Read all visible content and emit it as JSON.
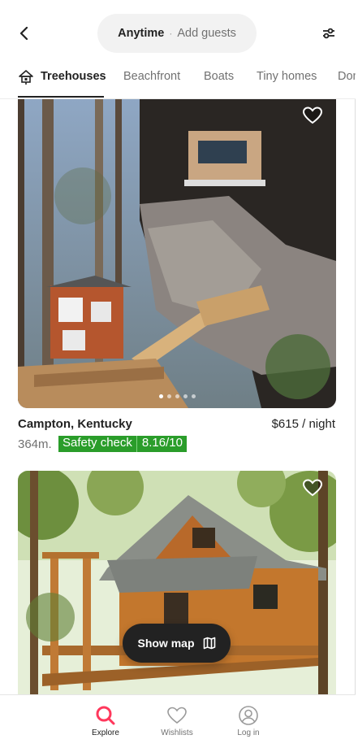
{
  "search": {
    "when": "Anytime",
    "separator": "·",
    "who": "Add guests"
  },
  "tabs": [
    {
      "label": "Treehouses",
      "active": true
    },
    {
      "label": "Beachfront",
      "active": false
    },
    {
      "label": "Boats",
      "active": false
    },
    {
      "label": "Tiny homes",
      "active": false
    },
    {
      "label": "Dom",
      "active": false
    }
  ],
  "listings": [
    {
      "location": "Campton, Kentucky",
      "price": "$615 / night",
      "distance": "364m.",
      "safety_label": "Safety check",
      "safety_score": "8.16/10",
      "photo_count": 5,
      "current_photo": 1
    }
  ],
  "show_map": {
    "label": "Show map"
  },
  "bottom_nav": [
    {
      "label": "Explore",
      "icon": "search-icon",
      "active": true
    },
    {
      "label": "Wishlists",
      "icon": "heart-icon",
      "active": false
    },
    {
      "label": "Log in",
      "icon": "user-circle-icon",
      "active": false
    }
  ],
  "colors": {
    "accent": "#ff385c",
    "safety": "#2a9d2a",
    "text": "#222222",
    "muted": "#717171"
  }
}
